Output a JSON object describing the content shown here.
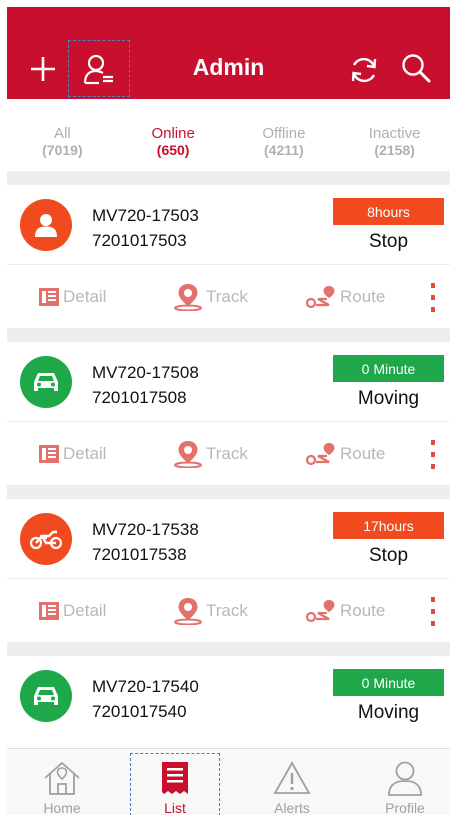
{
  "header": {
    "title": "Admin"
  },
  "tabs": [
    {
      "label": "All",
      "count": "(7019)",
      "active": false
    },
    {
      "label": "Online",
      "count": "(650)",
      "active": true
    },
    {
      "label": "Offline",
      "count": "(4211)",
      "active": false
    },
    {
      "label": "Inactive",
      "count": "(2158)",
      "active": false
    }
  ],
  "actions": {
    "detail": "Detail",
    "track": "Track",
    "route": "Route"
  },
  "devices": [
    {
      "name": "MV720-17503",
      "id": "7201017503",
      "duration": "8hours",
      "state": "Stop",
      "icon": "person-icon",
      "status_color": "#f04a1e"
    },
    {
      "name": "MV720-17508",
      "id": "7201017508",
      "duration": "0 Minute",
      "state": "Moving",
      "icon": "car-icon",
      "status_color": "#1ea84a"
    },
    {
      "name": "MV720-17538",
      "id": "7201017538",
      "duration": "17hours",
      "state": "Stop",
      "icon": "motorcycle-icon",
      "status_color": "#f04a1e"
    },
    {
      "name": "MV720-17540",
      "id": "7201017540",
      "duration": "0 Minute",
      "state": "Moving",
      "icon": "car-icon",
      "status_color": "#1ea84a"
    }
  ],
  "nav": {
    "home": "Home",
    "list": "List",
    "alerts": "Alerts",
    "profile": "Profile",
    "active": "List"
  },
  "colors": {
    "brand": "#c8102e",
    "stop": "#f04a1e",
    "moving": "#1ea84a"
  }
}
